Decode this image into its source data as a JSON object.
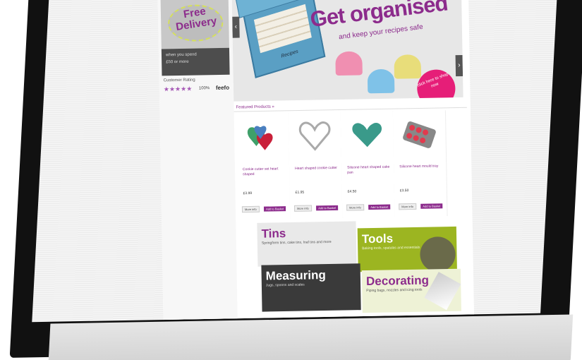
{
  "header": {
    "tabs": [
      "",
      "",
      ""
    ]
  },
  "sidebar": {
    "promo_title": "Free Delivery",
    "promo_line1": "when you spend",
    "promo_line2": "£50 or more",
    "rating_label": "Customer Rating",
    "stars": "★★★★★",
    "reviews": "100%",
    "brand": "feefo"
  },
  "banner": {
    "headline": "Get organised",
    "subline": "and keep your recipes safe",
    "box_label": "Recipes",
    "badge_text": "click here to shop now",
    "prev": "‹",
    "next": "›"
  },
  "featured": {
    "heading": "Featured Products »",
    "products": [
      {
        "name": "Cookie cutter set heart shaped",
        "price": "£3.99",
        "btn1": "More info",
        "btn2": "Add to Basket"
      },
      {
        "name": "Heart shaped cookie cutter",
        "price": "£1.95",
        "btn1": "More info",
        "btn2": "Add to Basket"
      },
      {
        "name": "Silicone heart shaped cake pan",
        "price": "£4.50",
        "btn1": "More info",
        "btn2": "Add to Basket"
      },
      {
        "name": "Silicone heart mould tray",
        "price": "£3.50",
        "btn1": "More info",
        "btn2": "Add to Basket"
      }
    ]
  },
  "categories": [
    {
      "title": "Tins",
      "desc": "Springform tins, cake tins, loaf tins and more",
      "color": "#8c2b8c"
    },
    {
      "title": "Tools",
      "desc": "Baking tools, spatulas and essentials",
      "color": "#ffffff"
    },
    {
      "title": "Measuring",
      "desc": "Jugs, spoons and scales",
      "color": "#ffffff"
    },
    {
      "title": "Decorating",
      "desc": "Piping bags, nozzles and icing tools",
      "color": "#8c2b8c"
    }
  ],
  "colors": {
    "brand": "#8c2b8c",
    "accent_green": "#9cb521",
    "pink": "#e61e78"
  }
}
